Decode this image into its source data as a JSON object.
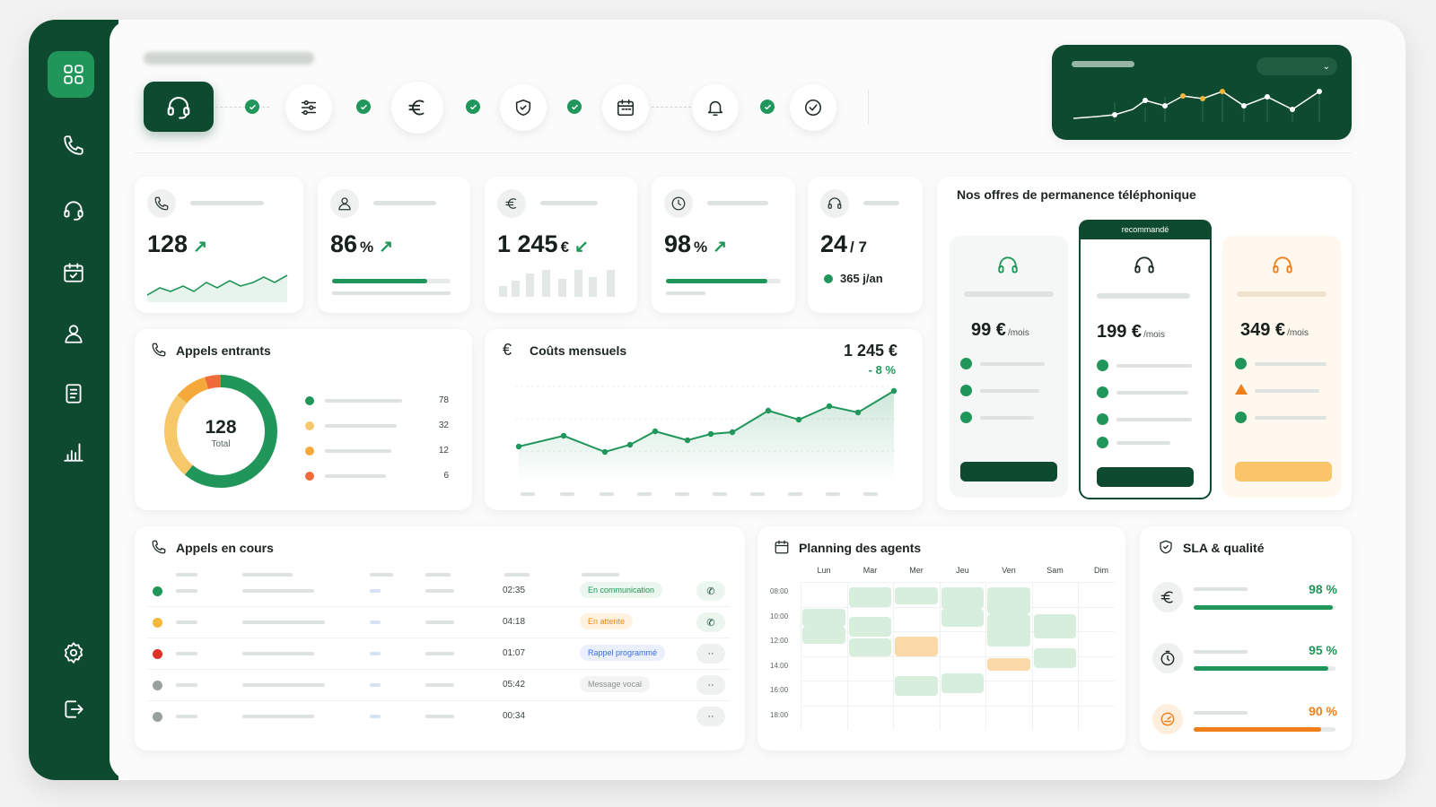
{
  "colors": {
    "brand": "#0e4a30",
    "accent": "#21965a",
    "warning": "#f4a93a",
    "danger": "#e0423a",
    "info": "#3a6ee8"
  },
  "sidebar": {
    "items": [
      {
        "icon": "grid-icon"
      },
      {
        "icon": "phone-icon"
      },
      {
        "icon": "headset-icon"
      },
      {
        "icon": "calendar-check-icon"
      },
      {
        "icon": "users-icon"
      },
      {
        "icon": "document-icon"
      },
      {
        "icon": "bar-chart-icon"
      },
      {
        "icon": "settings-icon"
      },
      {
        "icon": "logout-icon"
      }
    ]
  },
  "steps": [
    "headset-icon",
    "sliders-icon",
    "euro-icon",
    "shield-icon",
    "calendar-icon",
    "bell-icon",
    "check-circle-icon"
  ],
  "kpis": {
    "calls": {
      "value": "128",
      "icon": "phone-icon"
    },
    "rate": {
      "value": "86",
      "unit": "%",
      "icon": "user-icon",
      "progress": 0.8
    },
    "cost": {
      "value": "1 245",
      "unit": "€",
      "icon": "euro-icon"
    },
    "sla": {
      "value": "98",
      "unit": "%",
      "icon": "clock-icon",
      "progress": 0.88
    },
    "availability": {
      "value": "24",
      "unit": "/ 7",
      "sub": "365 j/an",
      "icon": "headset-icon"
    }
  },
  "incoming": {
    "title": "Appels entrants",
    "total": "128",
    "total_label": "Total",
    "legend": [
      {
        "value": "78",
        "color": "#21965a"
      },
      {
        "value": "32",
        "color": "#f6c86a"
      },
      {
        "value": "12",
        "color": "#f4a93a"
      },
      {
        "value": "6",
        "color": "#f06b3a"
      }
    ]
  },
  "costs": {
    "title": "Coûts mensuels",
    "value": "1 245 €",
    "delta": "- 8 %"
  },
  "offers": {
    "title": "Nos offres de permanence téléphonique",
    "badge": "recommandé",
    "plans": [
      {
        "price": "99 €",
        "per": "/mois"
      },
      {
        "price": "199 €",
        "per": "/mois"
      },
      {
        "price": "349 €",
        "per": "/mois"
      }
    ]
  },
  "calls_in_progress": {
    "title": "Appels en cours",
    "rows": [
      {
        "duration": "02:35",
        "status": "En communication",
        "dot": "#21965a"
      },
      {
        "duration": "04:18",
        "status": "En attente",
        "dot": "#f6b73a"
      },
      {
        "duration": "01:07",
        "status": "Rappel programmé",
        "dot": "#e0302a"
      },
      {
        "duration": "05:42",
        "status": "Message vocal",
        "dot": "#9aa09d"
      },
      {
        "duration": "00:34",
        "status": "",
        "dot": "#9aa09d"
      }
    ]
  },
  "planning": {
    "title": "Planning des agents",
    "days": [
      "Lun",
      "Mar",
      "Mer",
      "Jeu",
      "Ven",
      "Sam",
      "Dim"
    ],
    "hours": [
      "08:00",
      "10:00",
      "12:00",
      "14:00",
      "16:00",
      "18:00"
    ]
  },
  "sla": {
    "title": "SLA & qualité",
    "items": [
      {
        "value": "98 %",
        "icon": "euro-icon",
        "progress": 0.98,
        "color": "#21965a"
      },
      {
        "value": "95 %",
        "icon": "timer-icon",
        "progress": 0.95,
        "color": "#21965a"
      },
      {
        "value": "90 %",
        "icon": "gauge-icon",
        "progress": 0.9,
        "color": "#f07e1a"
      }
    ]
  }
}
